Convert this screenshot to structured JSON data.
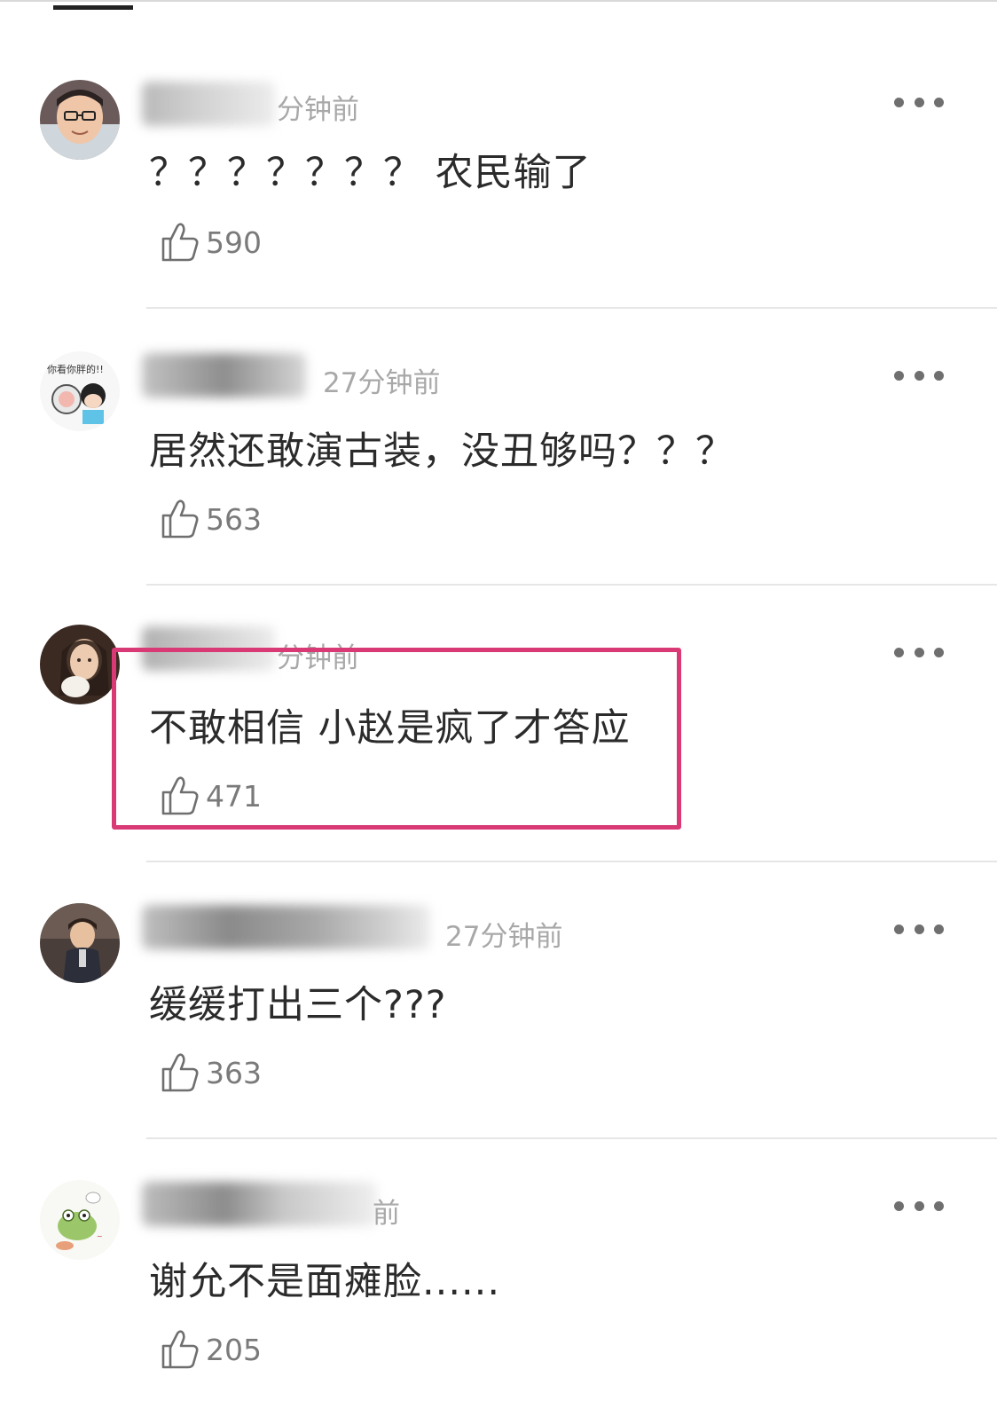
{
  "header": {
    "active_tab_indicator": "underline"
  },
  "comments": [
    {
      "avatar": "avatar-boy-glasses",
      "name_hidden": true,
      "time": "分钟前",
      "text": "？？？？？？？ 农民输了",
      "likes": "590"
    },
    {
      "avatar": "avatar-cartoon-sticker",
      "name_hidden": true,
      "time": "27分钟前",
      "text": "居然还敢演古装，没丑够吗？？？",
      "likes": "563"
    },
    {
      "avatar": "avatar-woman-portrait",
      "name_hidden": true,
      "time": "分钟前",
      "text": "不敢相信 小赵是疯了才答应",
      "likes": "471",
      "highlighted": true
    },
    {
      "avatar": "avatar-child-photo",
      "name_hidden": true,
      "time": "27分钟前",
      "text": "缓缓打出三个???",
      "likes": "363"
    },
    {
      "avatar": "avatar-frog-cartoon",
      "name_hidden": true,
      "time": "前",
      "text": "谢允不是面瘫脸......",
      "likes": "205"
    }
  ],
  "colors": {
    "highlight_border": "#d93a76",
    "meta_text": "#a8a8a8",
    "divider": "#e6e6e6"
  },
  "icons": {
    "more": "more-dots-icon",
    "like": "thumbs-up-icon"
  }
}
